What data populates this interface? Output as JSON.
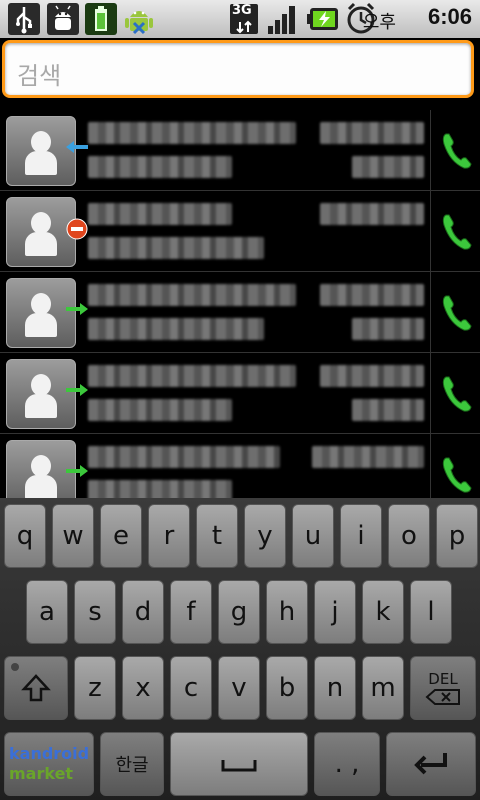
{
  "status_bar": {
    "network": "3G",
    "ampm": "오후",
    "time": "6:06",
    "icons": [
      "usb-icon",
      "debug-icon",
      "battery-app-icon",
      "android-icon",
      "signal-icon",
      "battery-icon",
      "alarm-icon"
    ]
  },
  "search": {
    "placeholder": "검색"
  },
  "contacts": [
    {
      "call_type": "incoming",
      "type_color": "#3aa0e0"
    },
    {
      "call_type": "missed",
      "type_color": "#e0461e"
    },
    {
      "call_type": "outgoing",
      "type_color": "#3cc83c"
    },
    {
      "call_type": "outgoing",
      "type_color": "#3cc83c"
    },
    {
      "call_type": "outgoing",
      "type_color": "#3cc83c"
    }
  ],
  "keyboard": {
    "row1": [
      "q",
      "w",
      "e",
      "r",
      "t",
      "y",
      "u",
      "i",
      "o",
      "p"
    ],
    "row2": [
      "a",
      "s",
      "d",
      "f",
      "g",
      "h",
      "j",
      "k",
      "l"
    ],
    "row3": [
      "z",
      "x",
      "c",
      "v",
      "b",
      "n",
      "m"
    ],
    "del_label": "DEL",
    "lang_label": "한글",
    "punct_label": ". ,",
    "brand_line1": "kandroid",
    "brand_line2": "market"
  },
  "colors": {
    "accent": "#ff9a18",
    "call_green": "#3cc83c"
  }
}
